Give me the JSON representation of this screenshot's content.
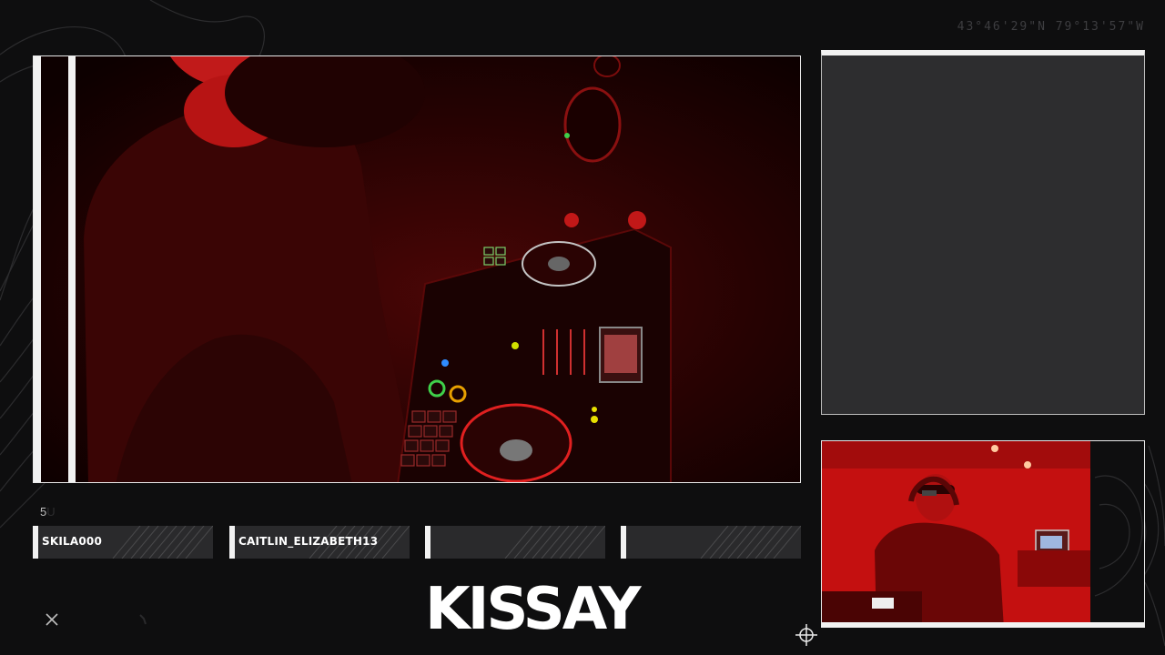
{
  "overlay": {
    "coordinates": "43°46'29\"N 79°13'57\"W",
    "sub_label": "5",
    "sub_label_faded": "U",
    "logo_text": "KISSAY",
    "accent_color": "#e10a0a",
    "frame_color": "#f2f2f2",
    "panel_color": "#2d2d2f"
  },
  "recent_events": [
    {
      "name": "SKILA000"
    },
    {
      "name": "CAITLIN_ELIZABETH13"
    },
    {
      "name": ""
    },
    {
      "name": ""
    }
  ],
  "icons": {
    "close": "close-icon",
    "crosshair": "crosshair-icon"
  }
}
